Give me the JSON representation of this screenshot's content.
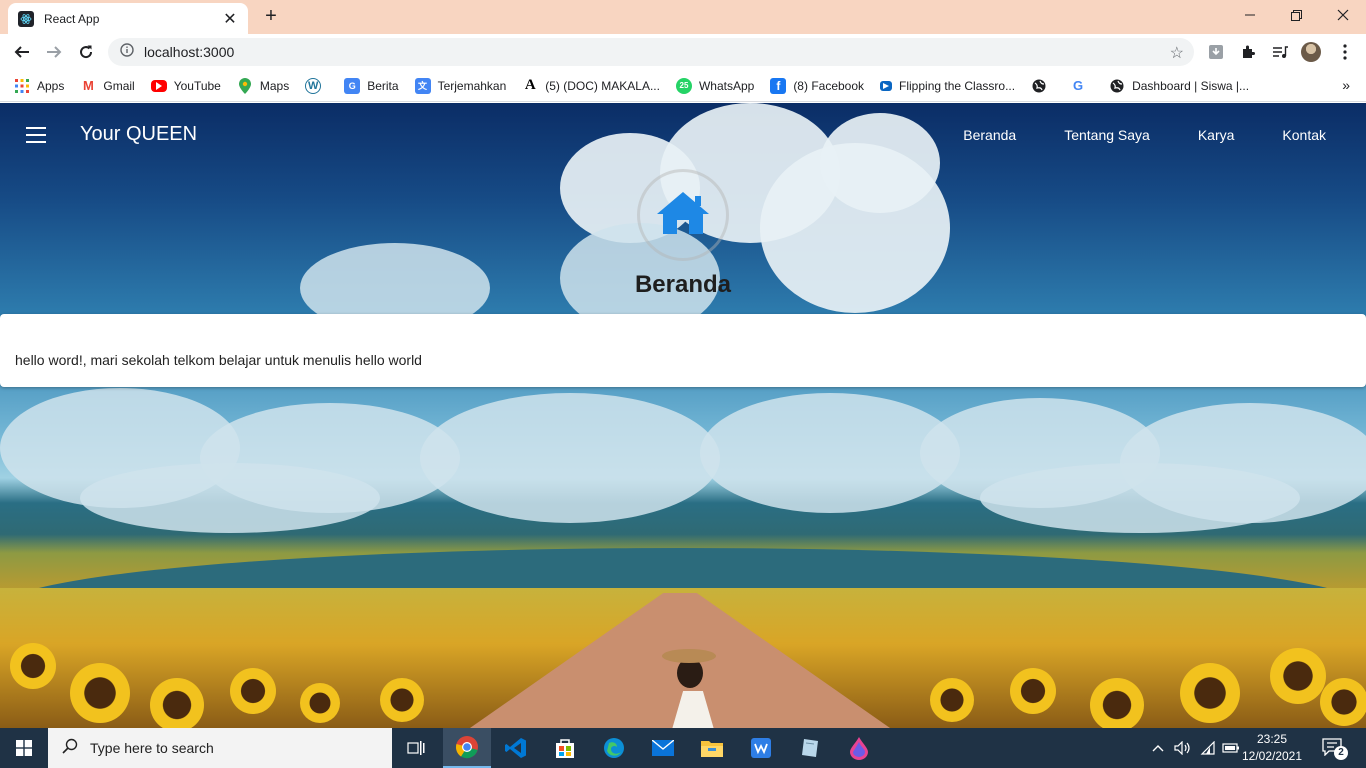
{
  "browser": {
    "tab_title": "React App",
    "url": "localhost:3000",
    "bookmarks": [
      {
        "label": "Apps",
        "icon": "apps-grid-icon"
      },
      {
        "label": "Gmail",
        "icon": "gmail-icon"
      },
      {
        "label": "YouTube",
        "icon": "youtube-icon"
      },
      {
        "label": "Maps",
        "icon": "maps-icon"
      },
      {
        "label": "",
        "icon": "wordpress-icon"
      },
      {
        "label": "Berita",
        "icon": "news-icon"
      },
      {
        "label": "Terjemahkan",
        "icon": "translate-icon"
      },
      {
        "label": "(5) (DOC) MAKALA...",
        "icon": "academia-icon"
      },
      {
        "label": "WhatsApp",
        "icon": "whatsapp-icon"
      },
      {
        "label": "(8) Facebook",
        "icon": "facebook-icon"
      },
      {
        "label": "Flipping the Classro...",
        "icon": "video-icon"
      },
      {
        "label": "",
        "icon": "globe-icon"
      },
      {
        "label": "",
        "icon": "google-icon"
      },
      {
        "label": "Dashboard | Siswa |...",
        "icon": "globe-icon"
      }
    ]
  },
  "app": {
    "brand": "Your QUEEN",
    "nav": [
      "Beranda",
      "Tentang Saya",
      "Karya",
      "Kontak"
    ],
    "hero_title": "Beranda",
    "card_text": "hello word!, mari sekolah telkom belajar untuk menulis hello world"
  },
  "taskbar": {
    "search_placeholder": "Type here to search",
    "time": "23:25",
    "date": "12/02/2021",
    "notification_count": "2"
  },
  "colors": {
    "tabstrip": "#f8d5c1",
    "accent_blue": "#1e88e5",
    "taskbar": "#1f3245"
  }
}
